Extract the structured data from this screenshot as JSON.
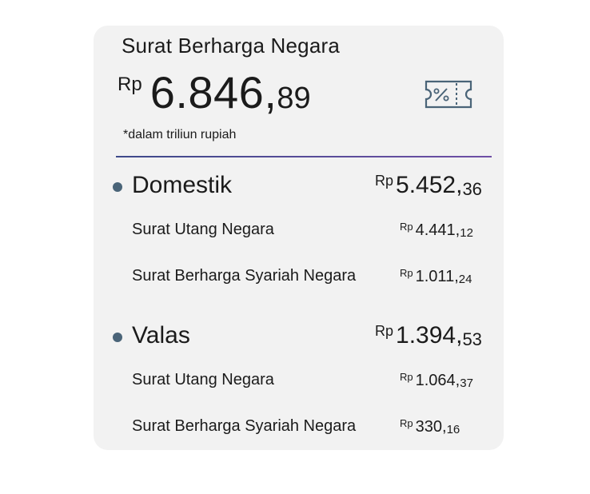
{
  "title": "Surat Berharga Negara",
  "total": {
    "currency": "Rp",
    "integer": "6.846,",
    "decimal": "89"
  },
  "note": "*dalam triliun rupiah",
  "icon": "ticket-percent-icon",
  "colors": {
    "bullet": "#4a6478",
    "divider_start": "#3e4a8a",
    "divider_end": "#6f4fa6"
  },
  "sections": [
    {
      "label": "Domestik",
      "amount": {
        "currency": "Rp",
        "integer": "5.452,",
        "decimal": "36"
      },
      "items": [
        {
          "label": "Surat Utang Negara",
          "currency": "Rp",
          "integer": "4.441,",
          "decimal": "12"
        },
        {
          "label": "Surat Berharga Syariah Negara",
          "currency": "Rp",
          "integer": "1.011,",
          "decimal": "24"
        }
      ]
    },
    {
      "label": "Valas",
      "amount": {
        "currency": "Rp",
        "integer": "1.394,",
        "decimal": "53"
      },
      "items": [
        {
          "label": "Surat Utang Negara",
          "currency": "Rp",
          "integer": "1.064,",
          "decimal": "37"
        },
        {
          "label": "Surat Berharga Syariah Negara",
          "currency": "Rp",
          "integer": "330,",
          "decimal": "16"
        }
      ]
    }
  ]
}
